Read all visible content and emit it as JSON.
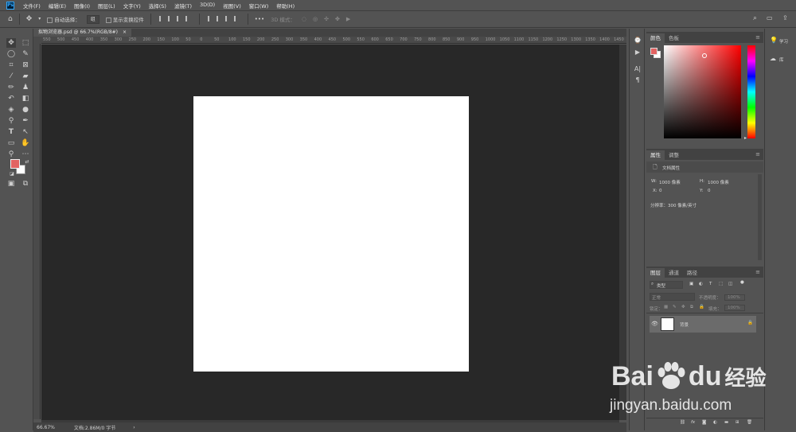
{
  "app": {
    "logo": "Ps"
  },
  "menubar": {
    "items": [
      "文件(F)",
      "编辑(E)",
      "图像(I)",
      "图层(L)",
      "文字(Y)",
      "选择(S)",
      "滤镜(T)",
      "3D(D)",
      "视图(V)",
      "窗口(W)",
      "帮助(H)"
    ]
  },
  "options": {
    "auto_select_label": "自动选择：",
    "auto_select_value": "组",
    "transform_label": "显示变换控件",
    "mode_3d_label": "3D 模式："
  },
  "document": {
    "tab_title": "拟物浏览器.psd @ 66.7%(RGB/8#)",
    "close": "×"
  },
  "ruler": {
    "top_ticks": [
      "550",
      "500",
      "450",
      "400",
      "350",
      "300",
      "250",
      "200",
      "150",
      "100",
      "50",
      "0",
      "50",
      "100",
      "150",
      "200",
      "250",
      "300",
      "350",
      "400",
      "450",
      "500",
      "550",
      "600",
      "650",
      "700",
      "750",
      "800",
      "850",
      "900",
      "950",
      "1000",
      "1050",
      "1100",
      "1150",
      "1200",
      "1250",
      "1300",
      "1350",
      "1400",
      "1450"
    ]
  },
  "status": {
    "zoom": "66.67%",
    "doc_info": "文档:2.86M/0 字节",
    "arrow": "›"
  },
  "panels": {
    "color": {
      "tabs": [
        "颜色",
        "色板"
      ]
    },
    "properties": {
      "tabs": [
        "属性",
        "调整"
      ],
      "title": "文档属性",
      "w_label": "W:",
      "w_value": "1000 像素",
      "h_label": "H:",
      "h_value": "1000 像素",
      "x_label": "X:",
      "x_value": "0",
      "y_label": "Y:",
      "y_value": "0",
      "resolution": "分辨率：300 像素/英寸"
    },
    "layers": {
      "tabs": [
        "图层",
        "通道",
        "路径"
      ],
      "filter_placeholder": "类型",
      "blend_mode": "正常",
      "opacity_label": "不透明度：",
      "opacity_value": "100%",
      "lock_label": "锁定：",
      "fill_label": "填充：",
      "fill_value": "100%",
      "layer_name": "背景"
    }
  },
  "right_rail": {
    "learn": "学习",
    "library": "库"
  },
  "watermark": {
    "brand": "Bai",
    "brand2": "du",
    "cn": "经验",
    "url": "jingyan.baidu.com"
  },
  "colors": {
    "foreground": "#e26362",
    "background": "#ffffff"
  }
}
